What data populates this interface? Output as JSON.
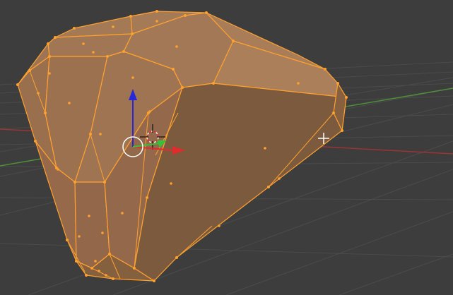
{
  "viewport": {
    "mode": "edit-mode",
    "background_color": "#3d3d3d",
    "grid_color": "#4a4a4a",
    "axis_x_color": "#b43c3c",
    "axis_y_color": "#56a83c",
    "selection_color": "#ffa12e",
    "face_fill_color": "#b97a3a"
  },
  "gizmo": {
    "type": "translate",
    "x_color": "#e02c2c",
    "y_color": "#35c23a",
    "z_color": "#2727d8",
    "pivot_color": "#ffffff"
  },
  "cursor": {
    "icon": "crosshair-cursor",
    "color": "#ffffff"
  },
  "icons": {
    "origin": "3d-cursor-icon"
  }
}
